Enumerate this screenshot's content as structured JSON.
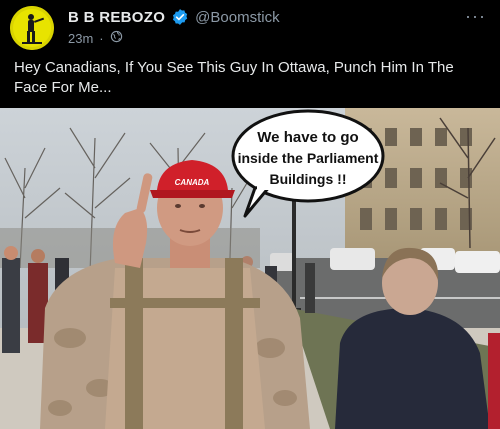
{
  "post": {
    "display_name": "B B REBOZO",
    "handle": "@Boomstick",
    "time": "23m",
    "text": "Hey Canadians, If You See This Guy In Ottawa, Punch Him In The Face For Me...",
    "more_label": "···",
    "verified": true
  },
  "media": {
    "speech_bubble_lines": [
      "We have to go",
      "inside the Parliament",
      "Buildings !!"
    ],
    "cap_text": "CANADA"
  },
  "colors": {
    "background": "#000000",
    "text": "#e7e9ea",
    "muted": "#8b98a5",
    "verified": "#1d9bf0",
    "avatar_bg": "#d9d400"
  },
  "icons": {
    "verified": "verified-badge-icon",
    "visibility": "globe-icon",
    "more": "more-dots-icon"
  }
}
